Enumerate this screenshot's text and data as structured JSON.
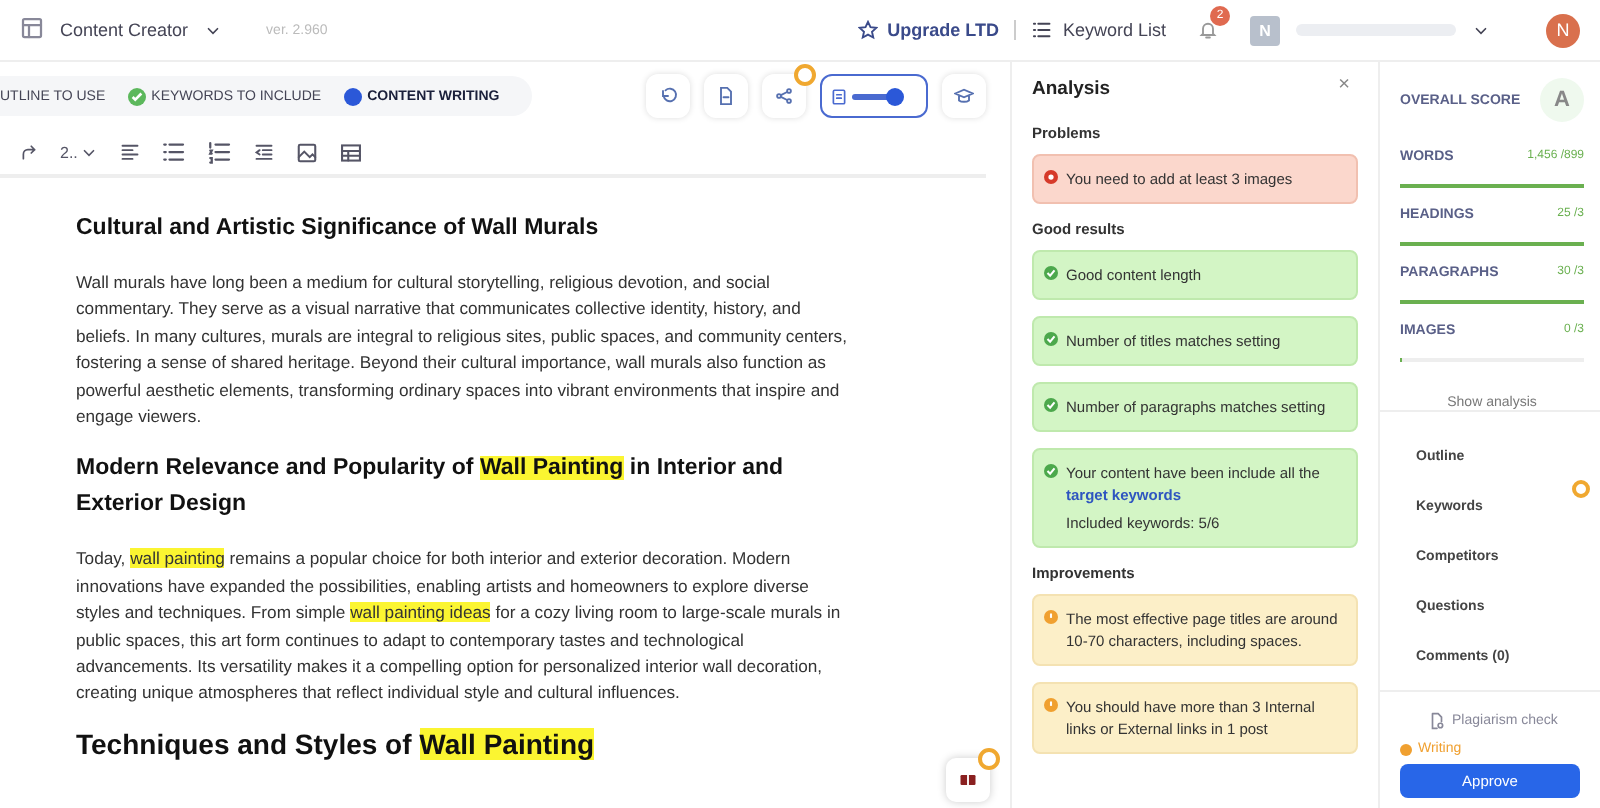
{
  "topbar": {
    "app": "Content Creator",
    "version": "ver. 2.960",
    "upgrade": "Upgrade LTD",
    "keyword_list": "Keyword List",
    "notifications": "2",
    "workspace_initial": "N",
    "user_initial": "N"
  },
  "steps": [
    {
      "label": "UTLINE TO USE",
      "done": false,
      "selected": false
    },
    {
      "label": "KEYWORDS TO INCLUDE",
      "done": true,
      "selected": false
    },
    {
      "label": "CONTENT WRITING",
      "done": false,
      "selected": true
    }
  ],
  "editor_toggle": {
    "on": true
  },
  "heading_select": "2..",
  "content": [
    {
      "kind": "h3",
      "segments": [
        {
          "text": "Cultural and Artistic Significance of Wall Murals",
          "highlighted": false
        }
      ]
    },
    {
      "kind": "p",
      "segments": [
        {
          "text": "Wall murals have long been a medium for cultural storytelling, religious devotion, and social commentary. They serve as a visual narrative that communicates collective identity, history, and beliefs. In many cultures, murals are integral to religious sites, public spaces, and community centers, fostering a sense of shared heritage. Beyond their cultural importance, wall murals also function as powerful aesthetic elements, transforming ordinary spaces into vibrant environments that inspire and engage viewers.",
          "highlighted": false
        }
      ]
    },
    {
      "kind": "h3",
      "segments": [
        {
          "text": "Modern Relevance and Popularity of ",
          "highlighted": false
        },
        {
          "text": "Wall Painting",
          "highlighted": true
        },
        {
          "text": " in Interior and Exterior Design",
          "highlighted": false
        }
      ]
    },
    {
      "kind": "p",
      "segments": [
        {
          "text": "Today, ",
          "highlighted": false
        },
        {
          "text": "wall painting",
          "highlighted": true
        },
        {
          "text": " remains a popular choice for both interior and exterior decoration. Modern innovations have expanded the possibilities, enabling artists and homeowners to explore diverse styles and techniques. From simple ",
          "highlighted": false
        },
        {
          "text": "wall painting ideas",
          "highlighted": true
        },
        {
          "text": " for a cozy living room to large-scale murals in public spaces, this art form continues to adapt to contemporary tastes and technological advancements. Its versatility makes it a compelling option for personalized interior wall decoration, creating unique atmospheres that reflect individual style and cultural influences.",
          "highlighted": false
        }
      ]
    },
    {
      "kind": "h2",
      "segments": [
        {
          "text": "Techniques and Styles of ",
          "highlighted": false
        },
        {
          "text": "Wall Painting",
          "highlighted": true
        }
      ]
    }
  ],
  "analysis": {
    "title": "Analysis",
    "close": "×",
    "sections": [
      {
        "title": "Problems",
        "items": [
          {
            "kind": "problem",
            "text": "You need to add at least 3 images"
          }
        ]
      },
      {
        "title": "Good results",
        "items": [
          {
            "kind": "good",
            "text": "Good content length"
          },
          {
            "kind": "good",
            "text": "Number of titles matches setting"
          },
          {
            "kind": "good",
            "text": "Number of paragraphs matches setting"
          },
          {
            "kind": "good",
            "text": "Your content have been include all the",
            "link": "target keywords",
            "note": "Included keywords: 5/6"
          }
        ]
      },
      {
        "title": "Improvements",
        "items": [
          {
            "kind": "improvement",
            "text": "The most effective page titles are around 10-70 characters, including spaces."
          },
          {
            "kind": "improvement",
            "text": "You should have more than 3 Internal links or External links in 1 post"
          }
        ]
      }
    ]
  },
  "score": {
    "title": "OVERALL SCORE",
    "grade": "A",
    "metrics": [
      {
        "name": "WORDS",
        "value": "1,456 /899",
        "level": 1
      },
      {
        "name": "HEADINGS",
        "value": "25 /3",
        "level": 1
      },
      {
        "name": "PARAGRAPHS",
        "value": "30 /3",
        "level": 1
      },
      {
        "name": "IMAGES",
        "value": "0 /3",
        "level": 0
      }
    ],
    "show_analysis": "Show analysis"
  },
  "nav": [
    {
      "label": "Outline",
      "badge": false
    },
    {
      "label": "Keywords",
      "badge": true
    },
    {
      "label": "Competitors",
      "badge": false
    },
    {
      "label": "Questions",
      "badge": false
    },
    {
      "label": "Comments (0)",
      "badge": false
    }
  ],
  "plagiarism": "Plagiarism check",
  "status": {
    "label": "Writing",
    "color": "#f0a030"
  },
  "approve": "Approve"
}
